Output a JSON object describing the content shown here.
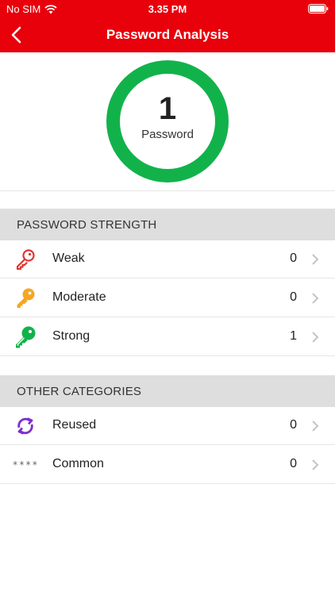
{
  "status_bar": {
    "carrier": "No SIM",
    "time": "3.35 PM"
  },
  "nav": {
    "title": "Password Analysis",
    "back_icon": "chevron-left-icon"
  },
  "summary": {
    "count": "1",
    "label": "Password",
    "ring_color": "#12b24b"
  },
  "sections": {
    "strength": {
      "title": "PASSWORD STRENGTH",
      "items": [
        {
          "label": "Weak",
          "count": "0",
          "icon": "key-weak-icon",
          "color": "#e3342f"
        },
        {
          "label": "Moderate",
          "count": "0",
          "icon": "key-moderate-icon",
          "color": "#f5a623"
        },
        {
          "label": "Strong",
          "count": "1",
          "icon": "key-strong-icon",
          "color": "#12b24b"
        }
      ]
    },
    "other": {
      "title": "OTHER CATEGORIES",
      "items": [
        {
          "label": "Reused",
          "count": "0",
          "icon": "reuse-icon",
          "color": "#7b2fd0"
        },
        {
          "label": "Common",
          "count": "0",
          "icon": "asterisks-icon",
          "glyph": "****"
        }
      ]
    }
  },
  "colors": {
    "brand": "#e8000b",
    "section_bg": "#dedede"
  }
}
